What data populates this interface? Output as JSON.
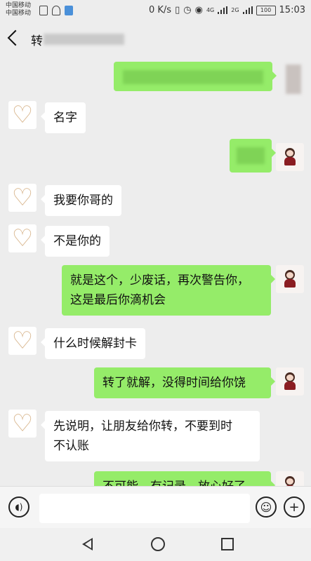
{
  "status_bar": {
    "carrier1": "中国移动",
    "carrier2": "中国移动",
    "net_speed": "0 K/s",
    "network1": "4G",
    "network2": "2G",
    "battery": "100",
    "time": "15:03"
  },
  "header": {
    "title": "转"
  },
  "messages": [
    {
      "side": "right",
      "text": ""
    },
    {
      "side": "left",
      "text": "名字"
    },
    {
      "side": "right",
      "text": ""
    },
    {
      "side": "left",
      "text": "我要你哥的"
    },
    {
      "side": "left",
      "text": "不是你的"
    },
    {
      "side": "right",
      "line1": "就是这个，少废话，再次警告你，",
      "line2": "这是最后你滴机会"
    },
    {
      "side": "left",
      "text": "什么时候解封卡"
    },
    {
      "side": "right",
      "text": "转了就解，没得时间给你饶"
    },
    {
      "side": "left",
      "line1": "先说明，让朋友给你转，不要到时",
      "line2": "不认账"
    },
    {
      "side": "right",
      "text": "不可能，有记录，放心好了"
    }
  ],
  "icons": {
    "voice": "voice-icon",
    "emoji": "emoji-icon",
    "add": "add-icon",
    "contact_avatar": "heart-avatar",
    "self_avatar": "girl-avatar"
  },
  "colors": {
    "sent_bubble": "#95ec69",
    "received_bubble": "#ffffff",
    "background": "#ededed"
  }
}
